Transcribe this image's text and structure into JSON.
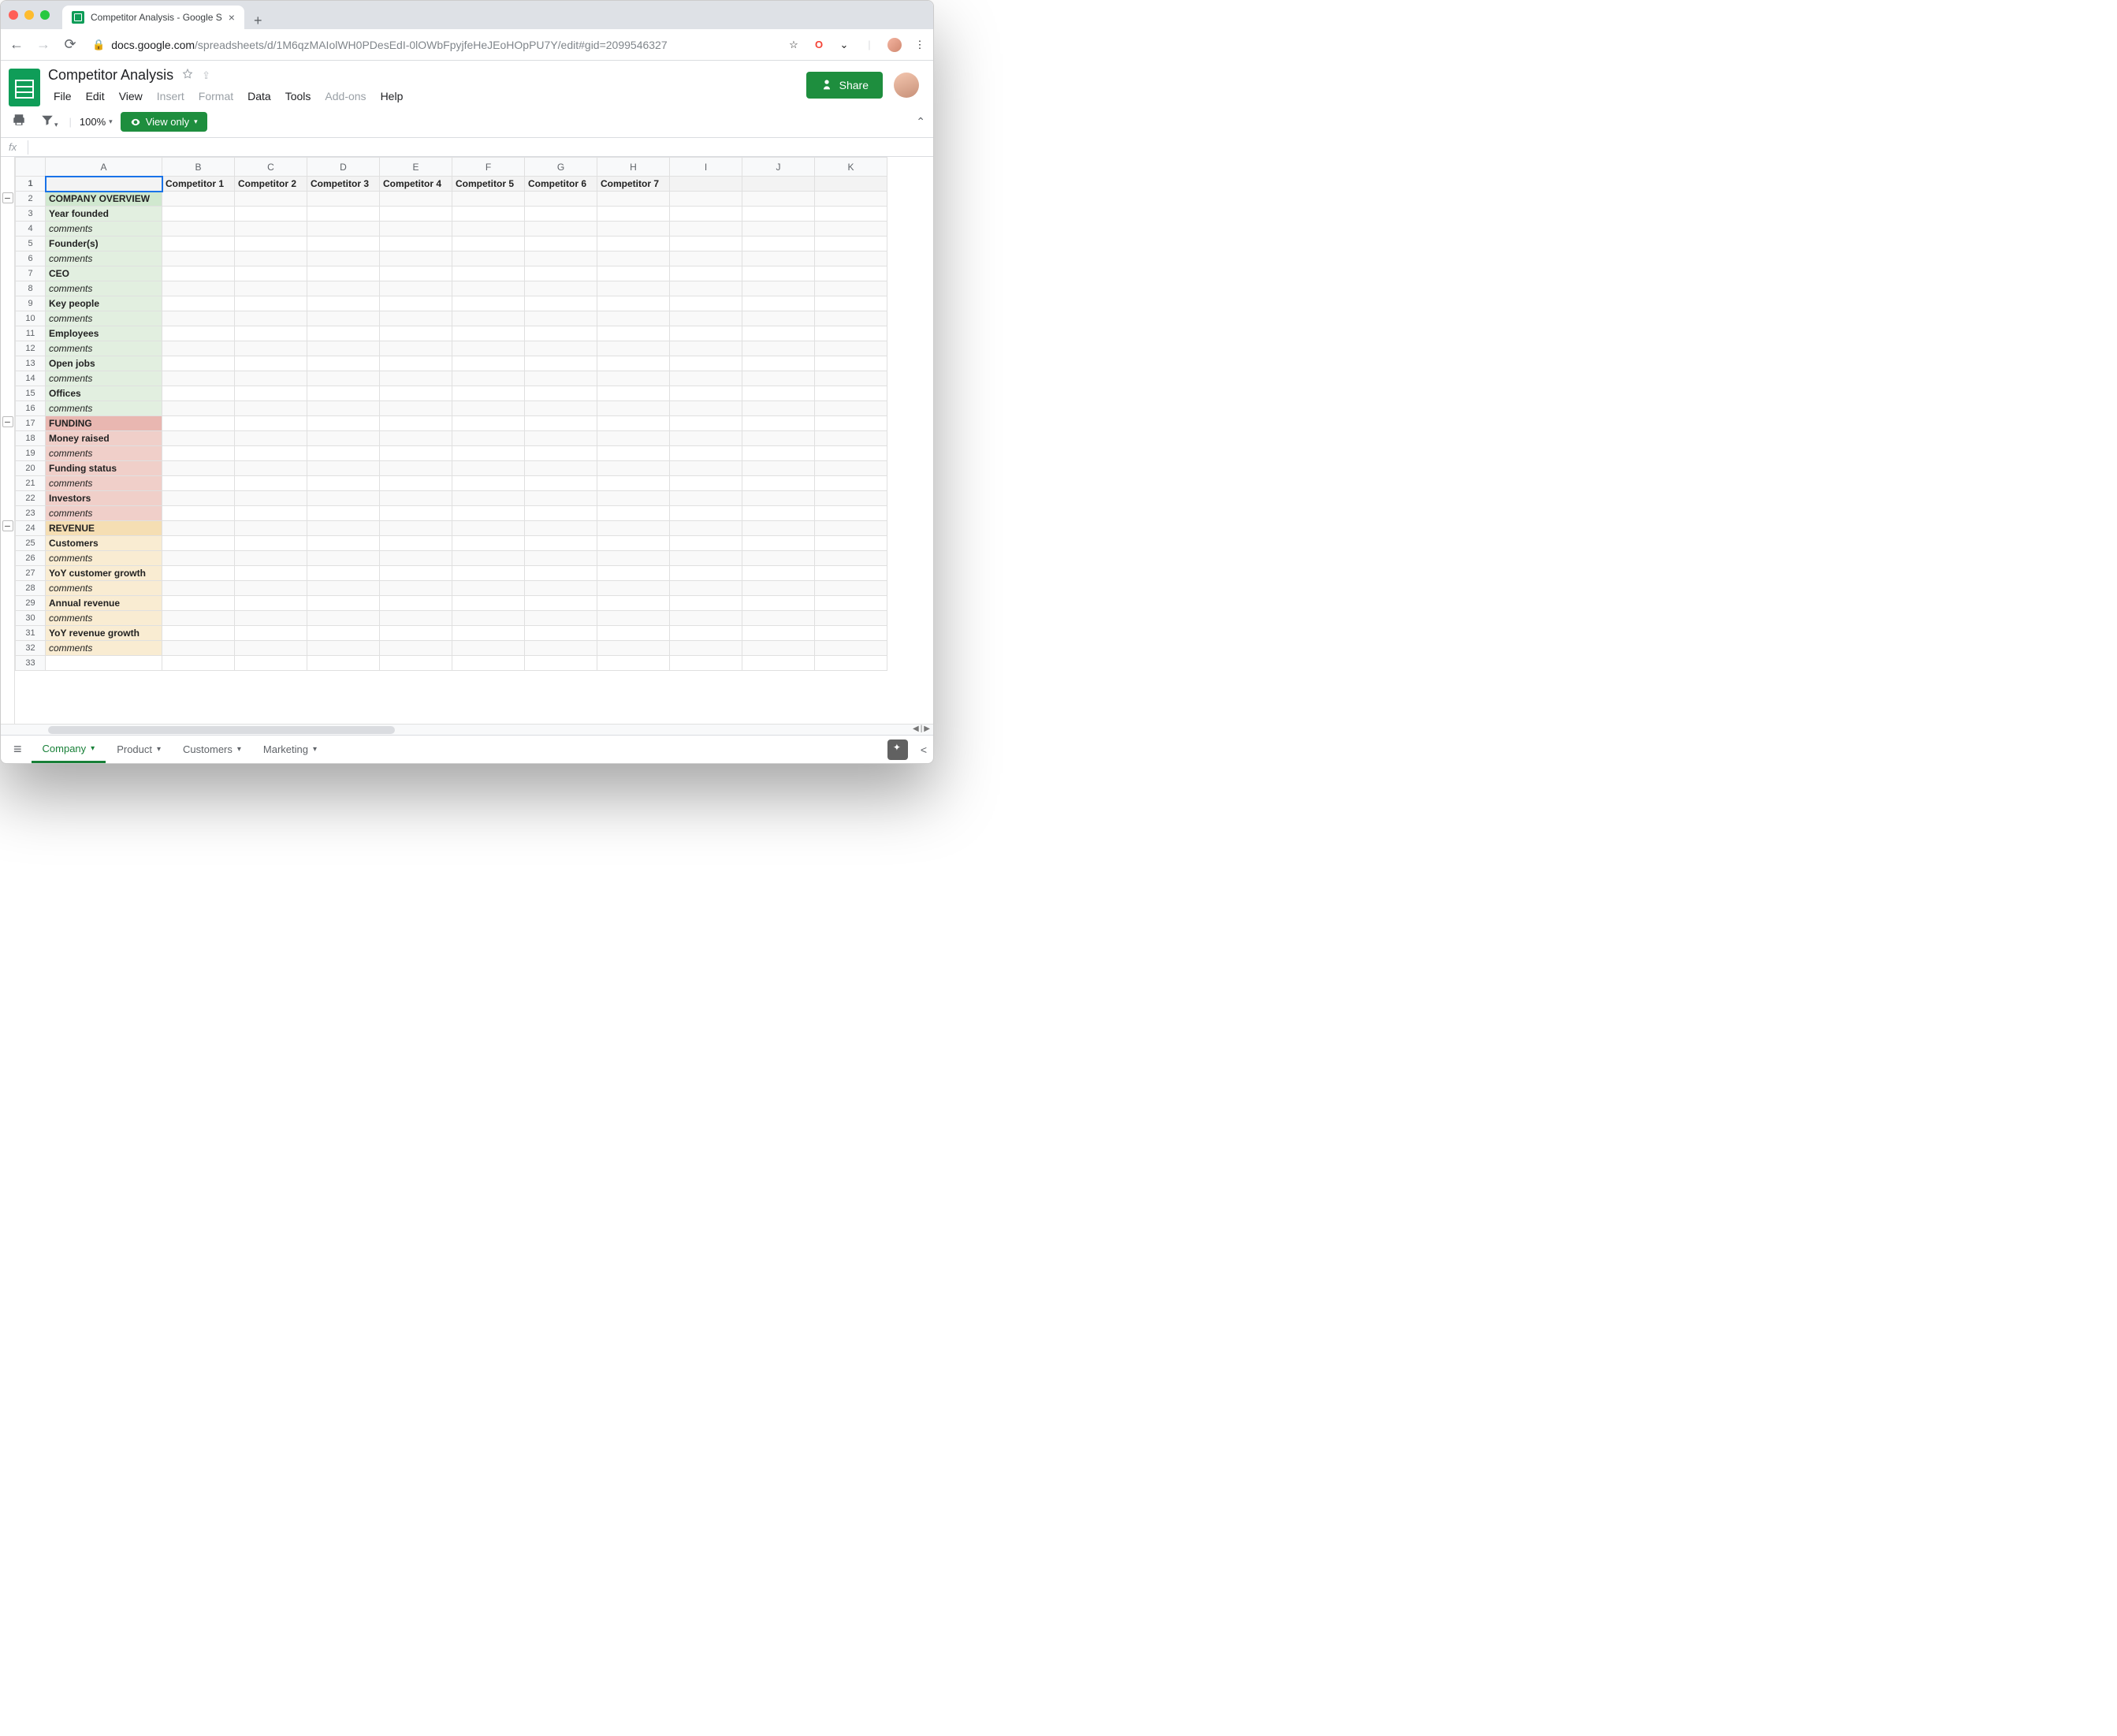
{
  "browser": {
    "tab_title": "Competitor Analysis - Google S",
    "url_domain": "docs.google.com",
    "url_path": "/spreadsheets/d/1M6qzMAIolWH0PDesEdI-0lOWbFpyjfeHeJEoHOpPU7Y/edit#gid=2099546327"
  },
  "doc": {
    "title": "Competitor Analysis",
    "menu": [
      "File",
      "Edit",
      "View",
      "Insert",
      "Format",
      "Data",
      "Tools",
      "Add-ons",
      "Help"
    ],
    "menu_dim": [
      "Insert",
      "Format",
      "Add-ons"
    ]
  },
  "toolbar": {
    "zoom": "100%",
    "view_only": "View only"
  },
  "share": {
    "label": "Share"
  },
  "columns": [
    "",
    "A",
    "B",
    "C",
    "D",
    "E",
    "F",
    "G",
    "H",
    "I",
    "J",
    "K"
  ],
  "header_row": [
    "",
    "Competitor 1",
    "Competitor 2",
    "Competitor 3",
    "Competitor 4",
    "Competitor 5",
    "Competitor 6",
    "Competitor 7",
    "",
    "",
    ""
  ],
  "rows": [
    {
      "n": 2,
      "label": "COMPANY OVERVIEW",
      "cls": "bg-green-h bold"
    },
    {
      "n": 3,
      "label": "Year founded",
      "cls": "bg-green bold"
    },
    {
      "n": 4,
      "label": "comments",
      "cls": "bg-green italic"
    },
    {
      "n": 5,
      "label": "Founder(s)",
      "cls": "bg-green bold"
    },
    {
      "n": 6,
      "label": "comments",
      "cls": "bg-green italic"
    },
    {
      "n": 7,
      "label": "CEO",
      "cls": "bg-green bold"
    },
    {
      "n": 8,
      "label": "comments",
      "cls": "bg-green italic"
    },
    {
      "n": 9,
      "label": "Key people",
      "cls": "bg-green bold"
    },
    {
      "n": 10,
      "label": "comments",
      "cls": "bg-green italic"
    },
    {
      "n": 11,
      "label": "Employees",
      "cls": "bg-green bold"
    },
    {
      "n": 12,
      "label": "comments",
      "cls": "bg-green italic"
    },
    {
      "n": 13,
      "label": "Open jobs",
      "cls": "bg-green bold"
    },
    {
      "n": 14,
      "label": "comments",
      "cls": "bg-green italic"
    },
    {
      "n": 15,
      "label": "Offices",
      "cls": "bg-green bold"
    },
    {
      "n": 16,
      "label": "comments",
      "cls": "bg-green italic"
    },
    {
      "n": 17,
      "label": "FUNDING",
      "cls": "bg-red-h bold"
    },
    {
      "n": 18,
      "label": "Money raised",
      "cls": "bg-red bold"
    },
    {
      "n": 19,
      "label": "comments",
      "cls": "bg-red italic"
    },
    {
      "n": 20,
      "label": "Funding status",
      "cls": "bg-red bold"
    },
    {
      "n": 21,
      "label": "comments",
      "cls": "bg-red italic"
    },
    {
      "n": 22,
      "label": "Investors",
      "cls": "bg-red bold"
    },
    {
      "n": 23,
      "label": "comments",
      "cls": "bg-red italic"
    },
    {
      "n": 24,
      "label": "REVENUE",
      "cls": "bg-tan-h bold"
    },
    {
      "n": 25,
      "label": "Customers",
      "cls": "bg-tan bold"
    },
    {
      "n": 26,
      "label": "comments",
      "cls": "bg-tan italic"
    },
    {
      "n": 27,
      "label": "YoY customer growth",
      "cls": "bg-tan bold"
    },
    {
      "n": 28,
      "label": "comments",
      "cls": "bg-tan italic"
    },
    {
      "n": 29,
      "label": "Annual revenue",
      "cls": "bg-tan bold"
    },
    {
      "n": 30,
      "label": "comments",
      "cls": "bg-tan italic"
    },
    {
      "n": 31,
      "label": "YoY revenue growth",
      "cls": "bg-tan bold"
    },
    {
      "n": 32,
      "label": "comments",
      "cls": "bg-tan italic"
    },
    {
      "n": 33,
      "label": "",
      "cls": ""
    }
  ],
  "groups": [
    {
      "at": 2,
      "collapse": true
    },
    {
      "at": 17,
      "collapse": true
    },
    {
      "at": 24,
      "collapse": true
    }
  ],
  "sheet_tabs": [
    {
      "label": "Company",
      "active": true
    },
    {
      "label": "Product"
    },
    {
      "label": "Customers"
    },
    {
      "label": "Marketing"
    }
  ]
}
